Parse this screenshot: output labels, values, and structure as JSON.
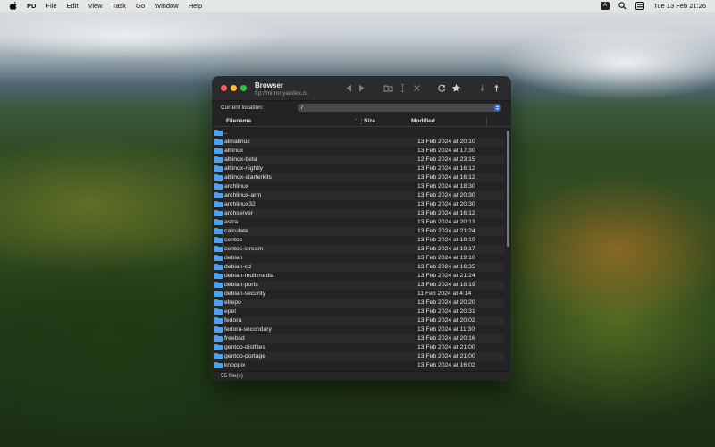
{
  "menubar": {
    "app_name": "PD",
    "items": [
      "File",
      "Edit",
      "View",
      "Task",
      "Go",
      "Window",
      "Help"
    ],
    "input_badge": "A",
    "clock": "Tue 13 Feb  21:26"
  },
  "window": {
    "title": "Browser",
    "subtitle": "ftp://mirror.yandex.ru",
    "location_label": "Current location:",
    "location_value": "/",
    "columns": {
      "filename": "Filename",
      "size": "Size",
      "modified": "Modified"
    },
    "status": "55 file(s)"
  },
  "files": [
    {
      "name": "..",
      "modified": ""
    },
    {
      "name": "almalinux",
      "modified": "13 Feb 2024 at 20:10"
    },
    {
      "name": "altlinux",
      "modified": "13 Feb 2024 at 17:30"
    },
    {
      "name": "altlinux-beta",
      "modified": "12 Feb 2024 at 23:15"
    },
    {
      "name": "altlinux-nightly",
      "modified": "13 Feb 2024 at 16:12"
    },
    {
      "name": "altlinux-starterkits",
      "modified": "13 Feb 2024 at 16:12"
    },
    {
      "name": "archlinux",
      "modified": "13 Feb 2024 at 18:30"
    },
    {
      "name": "archlinux-arm",
      "modified": "13 Feb 2024 at 20:30"
    },
    {
      "name": "archlinux32",
      "modified": "13 Feb 2024 at 20:30"
    },
    {
      "name": "archserver",
      "modified": "13 Feb 2024 at 16:12"
    },
    {
      "name": "astra",
      "modified": "13 Feb 2024 at 20:13"
    },
    {
      "name": "calculate",
      "modified": "13 Feb 2024 at 21:24"
    },
    {
      "name": "centos",
      "modified": "13 Feb 2024 at 19:19"
    },
    {
      "name": "centos-stream",
      "modified": "13 Feb 2024 at 19:17"
    },
    {
      "name": "debian",
      "modified": "13 Feb 2024 at 19:10"
    },
    {
      "name": "debian-cd",
      "modified": "13 Feb 2024 at 16:35"
    },
    {
      "name": "debian-multimedia",
      "modified": "13 Feb 2024 at 21:24"
    },
    {
      "name": "debian-ports",
      "modified": "13 Feb 2024 at 18:19"
    },
    {
      "name": "debian-security",
      "modified": "11 Feb 2024 at 4:14"
    },
    {
      "name": "elrepo",
      "modified": "13 Feb 2024 at 20:20"
    },
    {
      "name": "epel",
      "modified": "13 Feb 2024 at 20:31"
    },
    {
      "name": "fedora",
      "modified": "13 Feb 2024 at 20:02"
    },
    {
      "name": "fedora-secondary",
      "modified": "13 Feb 2024 at 11:30"
    },
    {
      "name": "freebsd",
      "modified": "13 Feb 2024 at 20:16"
    },
    {
      "name": "gentoo-distfiles",
      "modified": "13 Feb 2024 at 21:00"
    },
    {
      "name": "gentoo-portage",
      "modified": "13 Feb 2024 at 21:00"
    },
    {
      "name": "knoppix",
      "modified": "13 Feb 2024 at 16:02"
    }
  ],
  "icons": {
    "folder_color": "#4aa3f0",
    "accent": "#2f6fe0"
  }
}
